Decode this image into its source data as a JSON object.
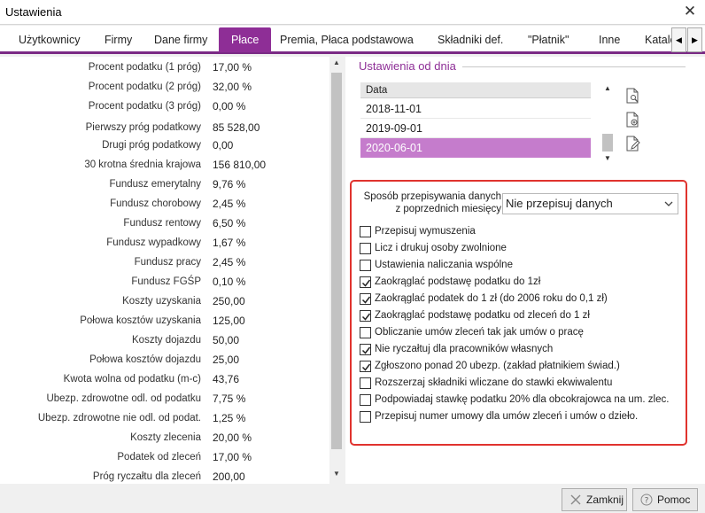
{
  "window": {
    "title": "Ustawienia"
  },
  "tabs": [
    "Użytkownicy",
    "Firmy",
    "Dane firmy",
    "Płace",
    "Premia, Płaca podstawowa",
    "Składniki def.",
    "\"Płatnik\"",
    "Inne",
    "Katalo"
  ],
  "active_tab": "Płace",
  "params": [
    {
      "label": "Procent podatku (1 próg)",
      "value": "17,00 %"
    },
    {
      "label": "Procent podatku (2 próg)",
      "value": "32,00 %"
    },
    {
      "label": "Procent podatku (3 próg)",
      "value": "0,00 %"
    },
    {
      "label": "Pierwszy próg podatkowy",
      "value": "85 528,00"
    },
    {
      "label": "Drugi próg podatkowy",
      "value": "0,00"
    },
    {
      "label": "30 krotna średnia krajowa",
      "value": "156 810,00"
    },
    {
      "label": "Fundusz emerytalny",
      "value": "9,76 %"
    },
    {
      "label": "Fundusz chorobowy",
      "value": "2,45 %"
    },
    {
      "label": "Fundusz rentowy",
      "value": "6,50 %"
    },
    {
      "label": "Fundusz wypadkowy",
      "value": "1,67 %"
    },
    {
      "label": "Fundusz pracy",
      "value": "2,45 %"
    },
    {
      "label": "Fundusz FGŚP",
      "value": "0,10 %"
    },
    {
      "label": "Koszty uzyskania",
      "value": "250,00"
    },
    {
      "label": "Połowa kosztów uzyskania",
      "value": "125,00"
    },
    {
      "label": "Koszty dojazdu",
      "value": "50,00"
    },
    {
      "label": "Połowa kosztów dojazdu",
      "value": "25,00"
    },
    {
      "label": "Kwota wolna od podatku (m-c)",
      "value": "43,76"
    },
    {
      "label": "Ubezp. zdrowotne odl. od podatku",
      "value": "7,75 %"
    },
    {
      "label": "Ubezp. zdrowotne nie odl. od podat.",
      "value": "1,25 %"
    },
    {
      "label": "Koszty zlecenia",
      "value": "20,00 %"
    },
    {
      "label": "Podatek od zleceń",
      "value": "17,00 %"
    },
    {
      "label": "Próg ryczałtu dla zleceń",
      "value": "200,00"
    }
  ],
  "settings": {
    "title": "Ustawienia od dnia",
    "column_header": "Data",
    "dates": [
      "2018-11-01",
      "2019-09-01",
      "2020-06-01"
    ],
    "selected_date": "2020-06-01"
  },
  "copy": {
    "label": "Sposób przepisywania danych z poprzednich miesięcy",
    "selected": "Nie przepisuj danych"
  },
  "options": [
    {
      "label": "Przepisuj wymuszenia",
      "checked": false
    },
    {
      "label": "Licz i drukuj osoby zwolnione",
      "checked": false
    },
    {
      "label": "Ustawienia naliczania wspólne",
      "checked": false
    },
    {
      "label": "Zaokrąglać podstawę podatku do 1zł",
      "checked": true
    },
    {
      "label": "Zaokrąglać podatek do 1 zł (do 2006 roku do 0,1 zł)",
      "checked": true
    },
    {
      "label": "Zaokrąglać podstawę podatku od zleceń do 1 zł",
      "checked": true
    },
    {
      "label": "Obliczanie umów zleceń tak jak umów o pracę",
      "checked": false
    },
    {
      "label": "Nie ryczałtuj dla pracowników własnych",
      "checked": true
    },
    {
      "label": "Zgłoszono ponad 20 ubezp. (zakład płatnikiem świad.)",
      "checked": true
    },
    {
      "label": "Rozszerzaj składniki wliczane do stawki ekwiwalentu",
      "checked": false
    },
    {
      "label": "Podpowiadaj stawkę podatku 20% dla obcokrajowca na um. zlec.",
      "checked": false
    },
    {
      "label": "Przepisuj numer umowy dla umów zleceń i umów o dzieło.",
      "checked": false
    }
  ],
  "buttons": {
    "close": "Zamknij",
    "help": "Pomoc"
  },
  "colors": {
    "accent": "#8e2e96",
    "selection": "#c57ccc",
    "highlight_border": "#e0332e"
  },
  "icons": {
    "close": "close-icon",
    "tab_left": "chevron-left-icon",
    "tab_right": "chevron-right-icon",
    "doc_search": "document-search-icon",
    "doc_add": "document-add-icon",
    "doc_edit": "document-edit-icon",
    "dropdown": "chevron-down-icon",
    "close_btn": "close-x-icon",
    "help_btn": "help-icon"
  }
}
